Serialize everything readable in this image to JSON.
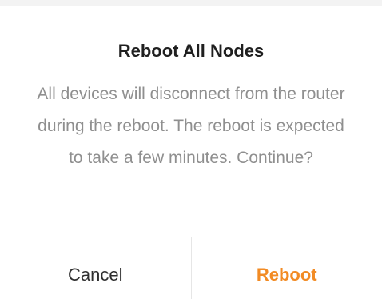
{
  "dialog": {
    "title": "Reboot All Nodes",
    "message": "All devices will disconnect from the router during the reboot. The reboot is expected to take a few minutes. Continue?",
    "cancel_label": "Cancel",
    "confirm_label": "Reboot"
  },
  "colors": {
    "accent": "#f28b24",
    "title": "#1f1f1f",
    "message": "#8f8f8f",
    "divider": "#e6e6e6"
  }
}
